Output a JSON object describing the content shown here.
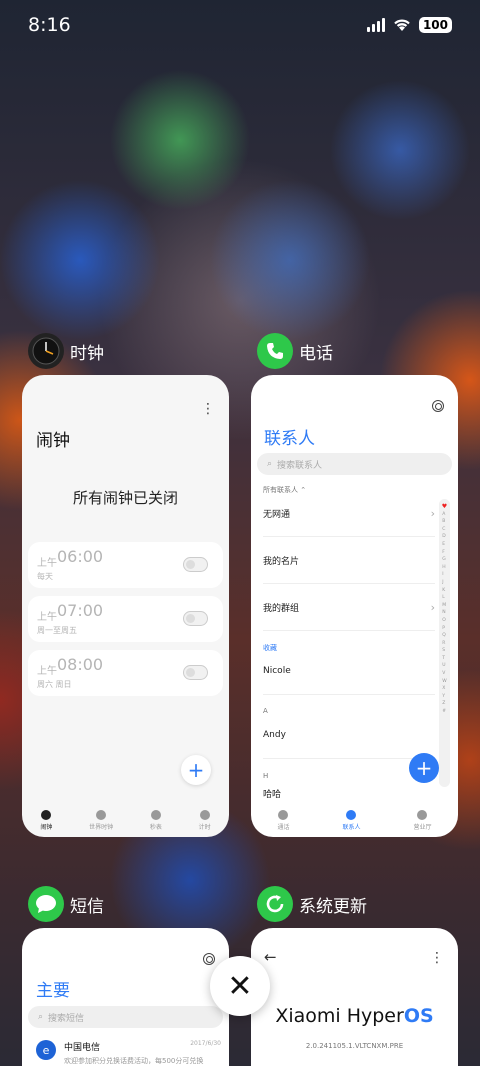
{
  "status": {
    "time": "8:16",
    "battery": "100"
  },
  "apps": {
    "clock": {
      "name": "时钟",
      "title": "闹钟",
      "empty_message": "所有闹钟已关闭",
      "alarms": [
        {
          "ampm": "上午",
          "time": "06:00",
          "repeat": "每天",
          "enabled": false
        },
        {
          "ampm": "上午",
          "time": "07:00",
          "repeat": "周一至周五",
          "enabled": false
        },
        {
          "ampm": "上午",
          "time": "08:00",
          "repeat": "周六 周日",
          "enabled": false
        }
      ],
      "nav": [
        "闹钟",
        "世界时钟",
        "秒表",
        "计时"
      ]
    },
    "phone": {
      "name": "电话",
      "title": "联系人",
      "search_placeholder": "搜索联系人",
      "group_label": "所有联系人 ⌃",
      "rows": [
        "无网通",
        "我的名片",
        "我的群组"
      ],
      "favorites_label": "收藏",
      "favorite": "Nicole",
      "section_a": "A",
      "contact_a": "Andy",
      "section_h": "H",
      "contact_h": "哈哈",
      "index_letters": [
        "A",
        "B",
        "C",
        "D",
        "E",
        "F",
        "G",
        "H",
        "I",
        "J",
        "K",
        "L",
        "M",
        "N",
        "O",
        "P",
        "Q",
        "R",
        "S",
        "T",
        "U",
        "V",
        "W",
        "X",
        "Y",
        "Z",
        "#"
      ],
      "nav": [
        "通话",
        "联系人",
        "营业厅"
      ]
    },
    "sms": {
      "name": "短信",
      "title": "主要",
      "search_placeholder": "搜索短信",
      "sender": "中国电信",
      "date": "2017/6/30",
      "preview": "欢迎参加积分兑换话费活动，每500分可兑换"
    },
    "update": {
      "name": "系统更新",
      "brand_prefix": "Xiaomi Hyper",
      "brand_suffix": "OS",
      "version": "2.0.241105.1.VLTCNXM.PRE"
    }
  },
  "colors": {
    "accent": "#2f7bf5",
    "phone_green": "#2ec84a"
  }
}
